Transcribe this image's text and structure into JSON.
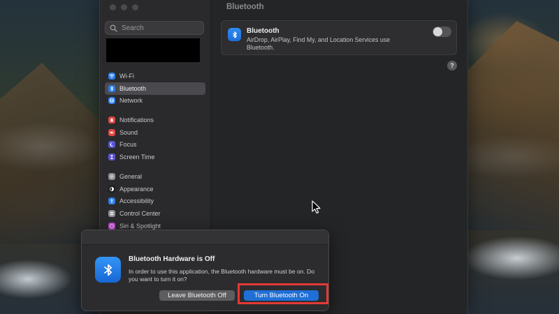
{
  "sidebar": {
    "search_placeholder": "Search",
    "groups": [
      {
        "items": [
          {
            "label": "Wi-Fi",
            "icon": "wifi-icon",
            "color": "#2b7de9"
          },
          {
            "label": "Bluetooth",
            "icon": "bluetooth-icon",
            "color": "#2b7de9",
            "selected": true
          },
          {
            "label": "Network",
            "icon": "globe-icon",
            "color": "#2b7de9"
          }
        ]
      },
      {
        "items": [
          {
            "label": "Notifications",
            "icon": "bell-icon",
            "color": "#e0463e"
          },
          {
            "label": "Sound",
            "icon": "speaker-icon",
            "color": "#e0463e"
          },
          {
            "label": "Focus",
            "icon": "moon-icon",
            "color": "#5a55d6"
          },
          {
            "label": "Screen Time",
            "icon": "hourglass-icon",
            "color": "#5a55d6"
          }
        ]
      },
      {
        "items": [
          {
            "label": "General",
            "icon": "gear-icon",
            "color": "#8e8e93"
          },
          {
            "label": "Appearance",
            "icon": "contrast-icon",
            "color": "#1c1c1e"
          },
          {
            "label": "Accessibility",
            "icon": "accessibility-icon",
            "color": "#2b7de9"
          },
          {
            "label": "Control Center",
            "icon": "sliders-icon",
            "color": "#8e8e93"
          },
          {
            "label": "Siri & Spotlight",
            "icon": "siri-icon",
            "color": "#c44ad3"
          }
        ]
      }
    ]
  },
  "main": {
    "title": "Bluetooth",
    "card": {
      "title": "Bluetooth",
      "description": "AirDrop, AirPlay, Find My, and Location Services use Bluetooth.",
      "toggle_on": false
    },
    "help_label": "?"
  },
  "dialog": {
    "title": "Bluetooth Hardware is Off",
    "message": "In order to use this application, the Bluetooth hardware must be on. Do you want to turn it on?",
    "leave_button": "Leave Bluetooth Off",
    "on_button": "Turn Bluetooth On"
  },
  "colors": {
    "accent": "#1f6fd6",
    "highlight": "#e53935"
  }
}
